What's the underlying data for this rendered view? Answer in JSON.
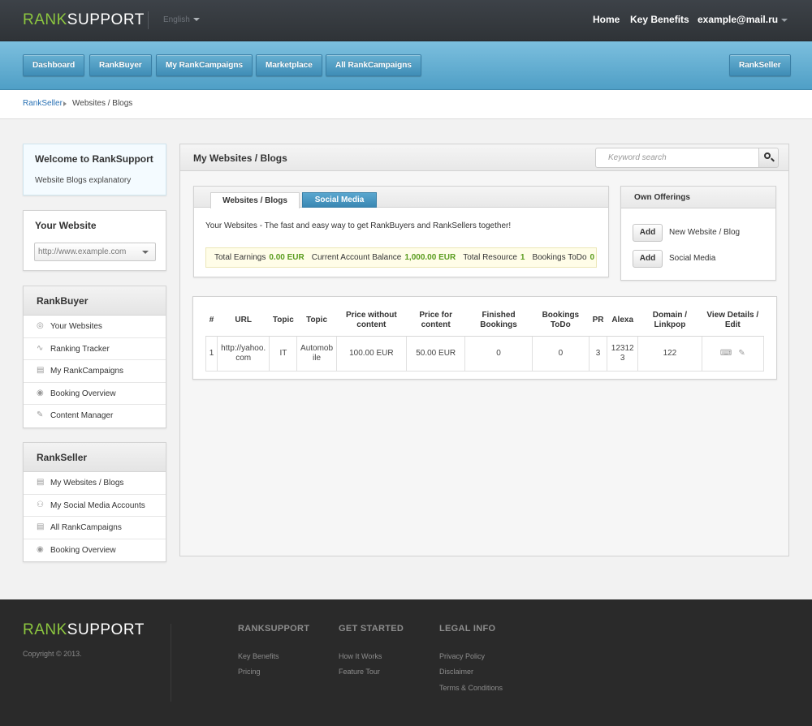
{
  "brand": {
    "part1": "RANK",
    "part2": "SUPPORT"
  },
  "header": {
    "language": "English",
    "nav": [
      "Home",
      "Key Benefits"
    ],
    "user": "example@mail.ru"
  },
  "mainnav": {
    "items": [
      "Dashboard",
      "RankBuyer",
      "My RankCampaigns",
      "Marketplace",
      "All RankCampaigns"
    ],
    "right": "RankSeller"
  },
  "breadcrumb": {
    "root": "RankSeller",
    "current": "Websites / Blogs"
  },
  "sidebar": {
    "welcome": {
      "title": "Welcome to RankSupport",
      "subtitle": "Website Blogs explanatory"
    },
    "your_website": {
      "title": "Your Website",
      "select_value": "http://www.example.com"
    },
    "rankbuyer": {
      "title": "RankBuyer",
      "items": [
        {
          "label": "Your Websites",
          "icon": "globe-icon"
        },
        {
          "label": "Ranking Tracker",
          "icon": "pulse-icon"
        },
        {
          "label": "My RankCampaigns",
          "icon": "document-icon"
        },
        {
          "label": "Booking Overview",
          "icon": "eye-icon"
        },
        {
          "label": "Content Manager",
          "icon": "pencil-icon"
        }
      ]
    },
    "rankseller": {
      "title": "RankSeller",
      "items": [
        {
          "label": "My Websites / Blogs",
          "icon": "list-icon"
        },
        {
          "label": "My Social Media Accounts",
          "icon": "social-icon"
        },
        {
          "label": "All RankCampaigns",
          "icon": "document-icon"
        },
        {
          "label": "Booking Overview",
          "icon": "eye-icon"
        }
      ]
    }
  },
  "main": {
    "title": "My Websites / Blogs",
    "search_placeholder": "Keyword search",
    "tabs": [
      "Websites / Blogs",
      "Social Media"
    ],
    "tagline": "Your Websites - The fast and easy way to get RankBuyers and RankSellers together!",
    "stats": {
      "earnings_label": "Total Earnings",
      "earnings": "0.00 EUR",
      "balance_label": "Current Account Balance",
      "balance": "1,000.00 EUR",
      "resource_label": "Total Resource",
      "resource": "1",
      "bookings_label": "Bookings ToDo",
      "bookings": "0"
    },
    "offerings": {
      "title": "Own Offerings",
      "add_label": "Add",
      "items": [
        "New Website / Blog",
        "Social Media"
      ]
    },
    "table": {
      "headers": [
        "#",
        "URL",
        "Topic",
        "Topic",
        "Price without content",
        "Price for content",
        "Finished Bookings",
        "Bookings ToDo",
        "PR",
        "Alexa",
        "Domain / Linkpop",
        "View Details / Edit"
      ],
      "rows": [
        {
          "num": "1",
          "url": "http://yahoo.com",
          "topic1": "IT",
          "topic2": "Automobile",
          "price_without": "100.00 EUR",
          "price_for": "50.00 EUR",
          "finished": "0",
          "todo": "0",
          "pr": "3",
          "alexa": "123123",
          "domain": "122"
        }
      ]
    }
  },
  "footer": {
    "copyright": "Copyright © 2013.",
    "cols": [
      {
        "title": "RANKSUPPORT",
        "links": [
          "Key Benefits",
          "Pricing"
        ]
      },
      {
        "title": "GET STARTED",
        "links": [
          "How It Works",
          "Feature Tour"
        ]
      },
      {
        "title": "LEGAL INFO",
        "links": [
          "Privacy Policy",
          "Disclaimer",
          "Terms & Conditions"
        ]
      }
    ]
  },
  "colors": {
    "brand_green": "#8cc63f",
    "nav_blue": "#5aa7cf",
    "topbar": "#35393e",
    "footer": "#2a2a2a"
  }
}
